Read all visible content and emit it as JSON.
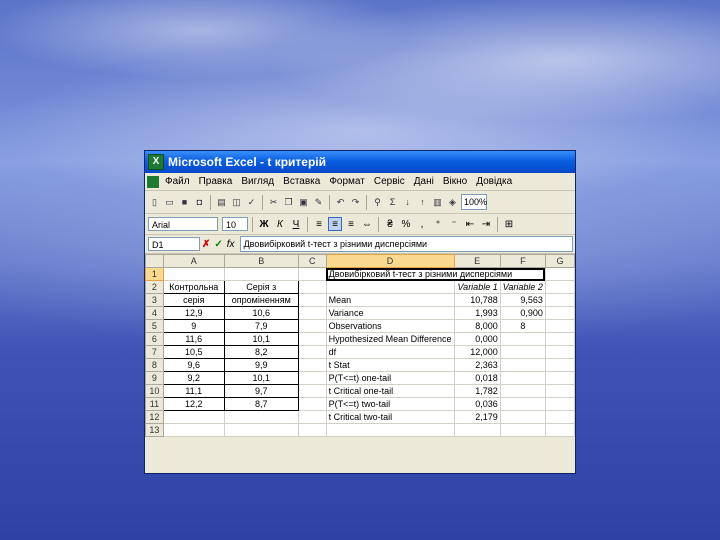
{
  "window": {
    "title": "Microsoft Excel - t критерій"
  },
  "menu": [
    "Файл",
    "Правка",
    "Вигляд",
    "Вставка",
    "Формат",
    "Сервіс",
    "Дані",
    "Вікно",
    "Довідка"
  ],
  "toolbar": {
    "zoom": "100%"
  },
  "format_bar": {
    "font": "Arial",
    "size": "10"
  },
  "formula_bar": {
    "name_box": "D1",
    "cancel_glyph": "✗",
    "ok_glyph": "✓",
    "fx_glyph": "fx",
    "content": "Двовибірковий t-тест з різними дисперсіями"
  },
  "sheet": {
    "columns": [
      "A",
      "B",
      "C",
      "D",
      "E",
      "F",
      "G"
    ],
    "rows": [
      "1",
      "2",
      "3",
      "4",
      "5",
      "6",
      "7",
      "8",
      "9",
      "10",
      "11",
      "12",
      "13"
    ],
    "d1": "Двовибірковий t-тест з різними дисперсіями",
    "a2": "Контрольна",
    "b2": "Серія з",
    "e2": "Variable 1",
    "f2": "Variable 2",
    "a3": "серія",
    "b3": "опроміненням",
    "colA": [
      "12,9",
      "9",
      "11,6",
      "10,5",
      "9,6",
      "9,2",
      "11,1",
      "12,2"
    ],
    "colB": [
      "10,6",
      "7,9",
      "10,1",
      "8,2",
      "9,9",
      "10,1",
      "9,7",
      "8,7"
    ],
    "colD": [
      "Mean",
      "Variance",
      "Observations",
      "Hypothesized Mean Difference",
      "df",
      "t Stat",
      "P(T<=t) one-tail",
      "t Critical one-tail",
      "P(T<=t) two-tail",
      "t Critical two-tail"
    ],
    "colE": [
      "10,788",
      "1,993",
      "8,000",
      "0,000",
      "12,000",
      "2,363",
      "0,018",
      "1,782",
      "0,036",
      "2,179"
    ],
    "colF": [
      "9,563",
      "0,900",
      "8"
    ]
  }
}
